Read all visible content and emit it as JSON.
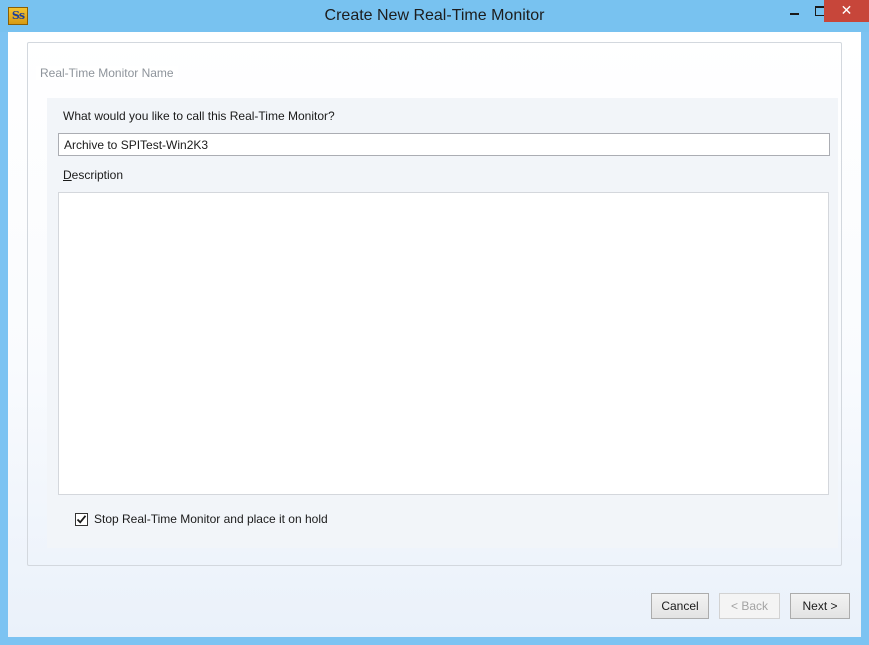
{
  "window": {
    "title": "Create New Real-Time Monitor",
    "app_icon_text": "Ss",
    "close_glyph": "✕"
  },
  "group": {
    "legend": "Real-Time Monitor Name"
  },
  "name_field": {
    "label": "What would you like to call this Real-Time Monitor?",
    "value": "Archive to SPITest-Win2K3"
  },
  "description": {
    "label_mnemonic": "D",
    "label_rest": "escription",
    "value": ""
  },
  "hold_option": {
    "label": "Stop Real-Time Monitor and place it on hold",
    "checked": true
  },
  "buttons": {
    "cancel": "Cancel",
    "back": "< Back",
    "next": "Next >"
  },
  "colors": {
    "titlebar": "#78c2f0",
    "close_button": "#c7463a"
  }
}
